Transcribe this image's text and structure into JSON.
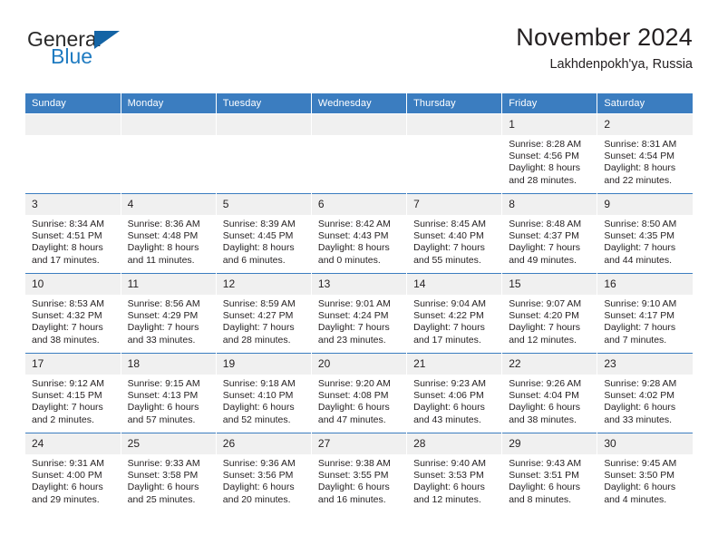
{
  "brand": {
    "name_top": "General",
    "name_bottom": "Blue",
    "color_dark": "#2a2a2a",
    "color_blue": "#1f7bc1",
    "triangle_color": "#1464a5"
  },
  "header": {
    "title": "November 2024",
    "subtitle": "Lakhdenpokh'ya, Russia"
  },
  "theme": {
    "header_row_bg": "#3b7dc0",
    "header_row_text": "#ffffff",
    "daynum_bg": "#f0f0f0",
    "cell_bg": "#ffffff",
    "text": "#231f20"
  },
  "weekdays": [
    "Sunday",
    "Monday",
    "Tuesday",
    "Wednesday",
    "Thursday",
    "Friday",
    "Saturday"
  ],
  "weeks": [
    [
      {
        "day": "",
        "detail": ""
      },
      {
        "day": "",
        "detail": ""
      },
      {
        "day": "",
        "detail": ""
      },
      {
        "day": "",
        "detail": ""
      },
      {
        "day": "",
        "detail": ""
      },
      {
        "day": "1",
        "detail": "Sunrise: 8:28 AM\nSunset: 4:56 PM\nDaylight: 8 hours\nand 28 minutes."
      },
      {
        "day": "2",
        "detail": "Sunrise: 8:31 AM\nSunset: 4:54 PM\nDaylight: 8 hours\nand 22 minutes."
      }
    ],
    [
      {
        "day": "3",
        "detail": "Sunrise: 8:34 AM\nSunset: 4:51 PM\nDaylight: 8 hours\nand 17 minutes."
      },
      {
        "day": "4",
        "detail": "Sunrise: 8:36 AM\nSunset: 4:48 PM\nDaylight: 8 hours\nand 11 minutes."
      },
      {
        "day": "5",
        "detail": "Sunrise: 8:39 AM\nSunset: 4:45 PM\nDaylight: 8 hours\nand 6 minutes."
      },
      {
        "day": "6",
        "detail": "Sunrise: 8:42 AM\nSunset: 4:43 PM\nDaylight: 8 hours\nand 0 minutes."
      },
      {
        "day": "7",
        "detail": "Sunrise: 8:45 AM\nSunset: 4:40 PM\nDaylight: 7 hours\nand 55 minutes."
      },
      {
        "day": "8",
        "detail": "Sunrise: 8:48 AM\nSunset: 4:37 PM\nDaylight: 7 hours\nand 49 minutes."
      },
      {
        "day": "9",
        "detail": "Sunrise: 8:50 AM\nSunset: 4:35 PM\nDaylight: 7 hours\nand 44 minutes."
      }
    ],
    [
      {
        "day": "10",
        "detail": "Sunrise: 8:53 AM\nSunset: 4:32 PM\nDaylight: 7 hours\nand 38 minutes."
      },
      {
        "day": "11",
        "detail": "Sunrise: 8:56 AM\nSunset: 4:29 PM\nDaylight: 7 hours\nand 33 minutes."
      },
      {
        "day": "12",
        "detail": "Sunrise: 8:59 AM\nSunset: 4:27 PM\nDaylight: 7 hours\nand 28 minutes."
      },
      {
        "day": "13",
        "detail": "Sunrise: 9:01 AM\nSunset: 4:24 PM\nDaylight: 7 hours\nand 23 minutes."
      },
      {
        "day": "14",
        "detail": "Sunrise: 9:04 AM\nSunset: 4:22 PM\nDaylight: 7 hours\nand 17 minutes."
      },
      {
        "day": "15",
        "detail": "Sunrise: 9:07 AM\nSunset: 4:20 PM\nDaylight: 7 hours\nand 12 minutes."
      },
      {
        "day": "16",
        "detail": "Sunrise: 9:10 AM\nSunset: 4:17 PM\nDaylight: 7 hours\nand 7 minutes."
      }
    ],
    [
      {
        "day": "17",
        "detail": "Sunrise: 9:12 AM\nSunset: 4:15 PM\nDaylight: 7 hours\nand 2 minutes."
      },
      {
        "day": "18",
        "detail": "Sunrise: 9:15 AM\nSunset: 4:13 PM\nDaylight: 6 hours\nand 57 minutes."
      },
      {
        "day": "19",
        "detail": "Sunrise: 9:18 AM\nSunset: 4:10 PM\nDaylight: 6 hours\nand 52 minutes."
      },
      {
        "day": "20",
        "detail": "Sunrise: 9:20 AM\nSunset: 4:08 PM\nDaylight: 6 hours\nand 47 minutes."
      },
      {
        "day": "21",
        "detail": "Sunrise: 9:23 AM\nSunset: 4:06 PM\nDaylight: 6 hours\nand 43 minutes."
      },
      {
        "day": "22",
        "detail": "Sunrise: 9:26 AM\nSunset: 4:04 PM\nDaylight: 6 hours\nand 38 minutes."
      },
      {
        "day": "23",
        "detail": "Sunrise: 9:28 AM\nSunset: 4:02 PM\nDaylight: 6 hours\nand 33 minutes."
      }
    ],
    [
      {
        "day": "24",
        "detail": "Sunrise: 9:31 AM\nSunset: 4:00 PM\nDaylight: 6 hours\nand 29 minutes."
      },
      {
        "day": "25",
        "detail": "Sunrise: 9:33 AM\nSunset: 3:58 PM\nDaylight: 6 hours\nand 25 minutes."
      },
      {
        "day": "26",
        "detail": "Sunrise: 9:36 AM\nSunset: 3:56 PM\nDaylight: 6 hours\nand 20 minutes."
      },
      {
        "day": "27",
        "detail": "Sunrise: 9:38 AM\nSunset: 3:55 PM\nDaylight: 6 hours\nand 16 minutes."
      },
      {
        "day": "28",
        "detail": "Sunrise: 9:40 AM\nSunset: 3:53 PM\nDaylight: 6 hours\nand 12 minutes."
      },
      {
        "day": "29",
        "detail": "Sunrise: 9:43 AM\nSunset: 3:51 PM\nDaylight: 6 hours\nand 8 minutes."
      },
      {
        "day": "30",
        "detail": "Sunrise: 9:45 AM\nSunset: 3:50 PM\nDaylight: 6 hours\nand 4 minutes."
      }
    ]
  ]
}
